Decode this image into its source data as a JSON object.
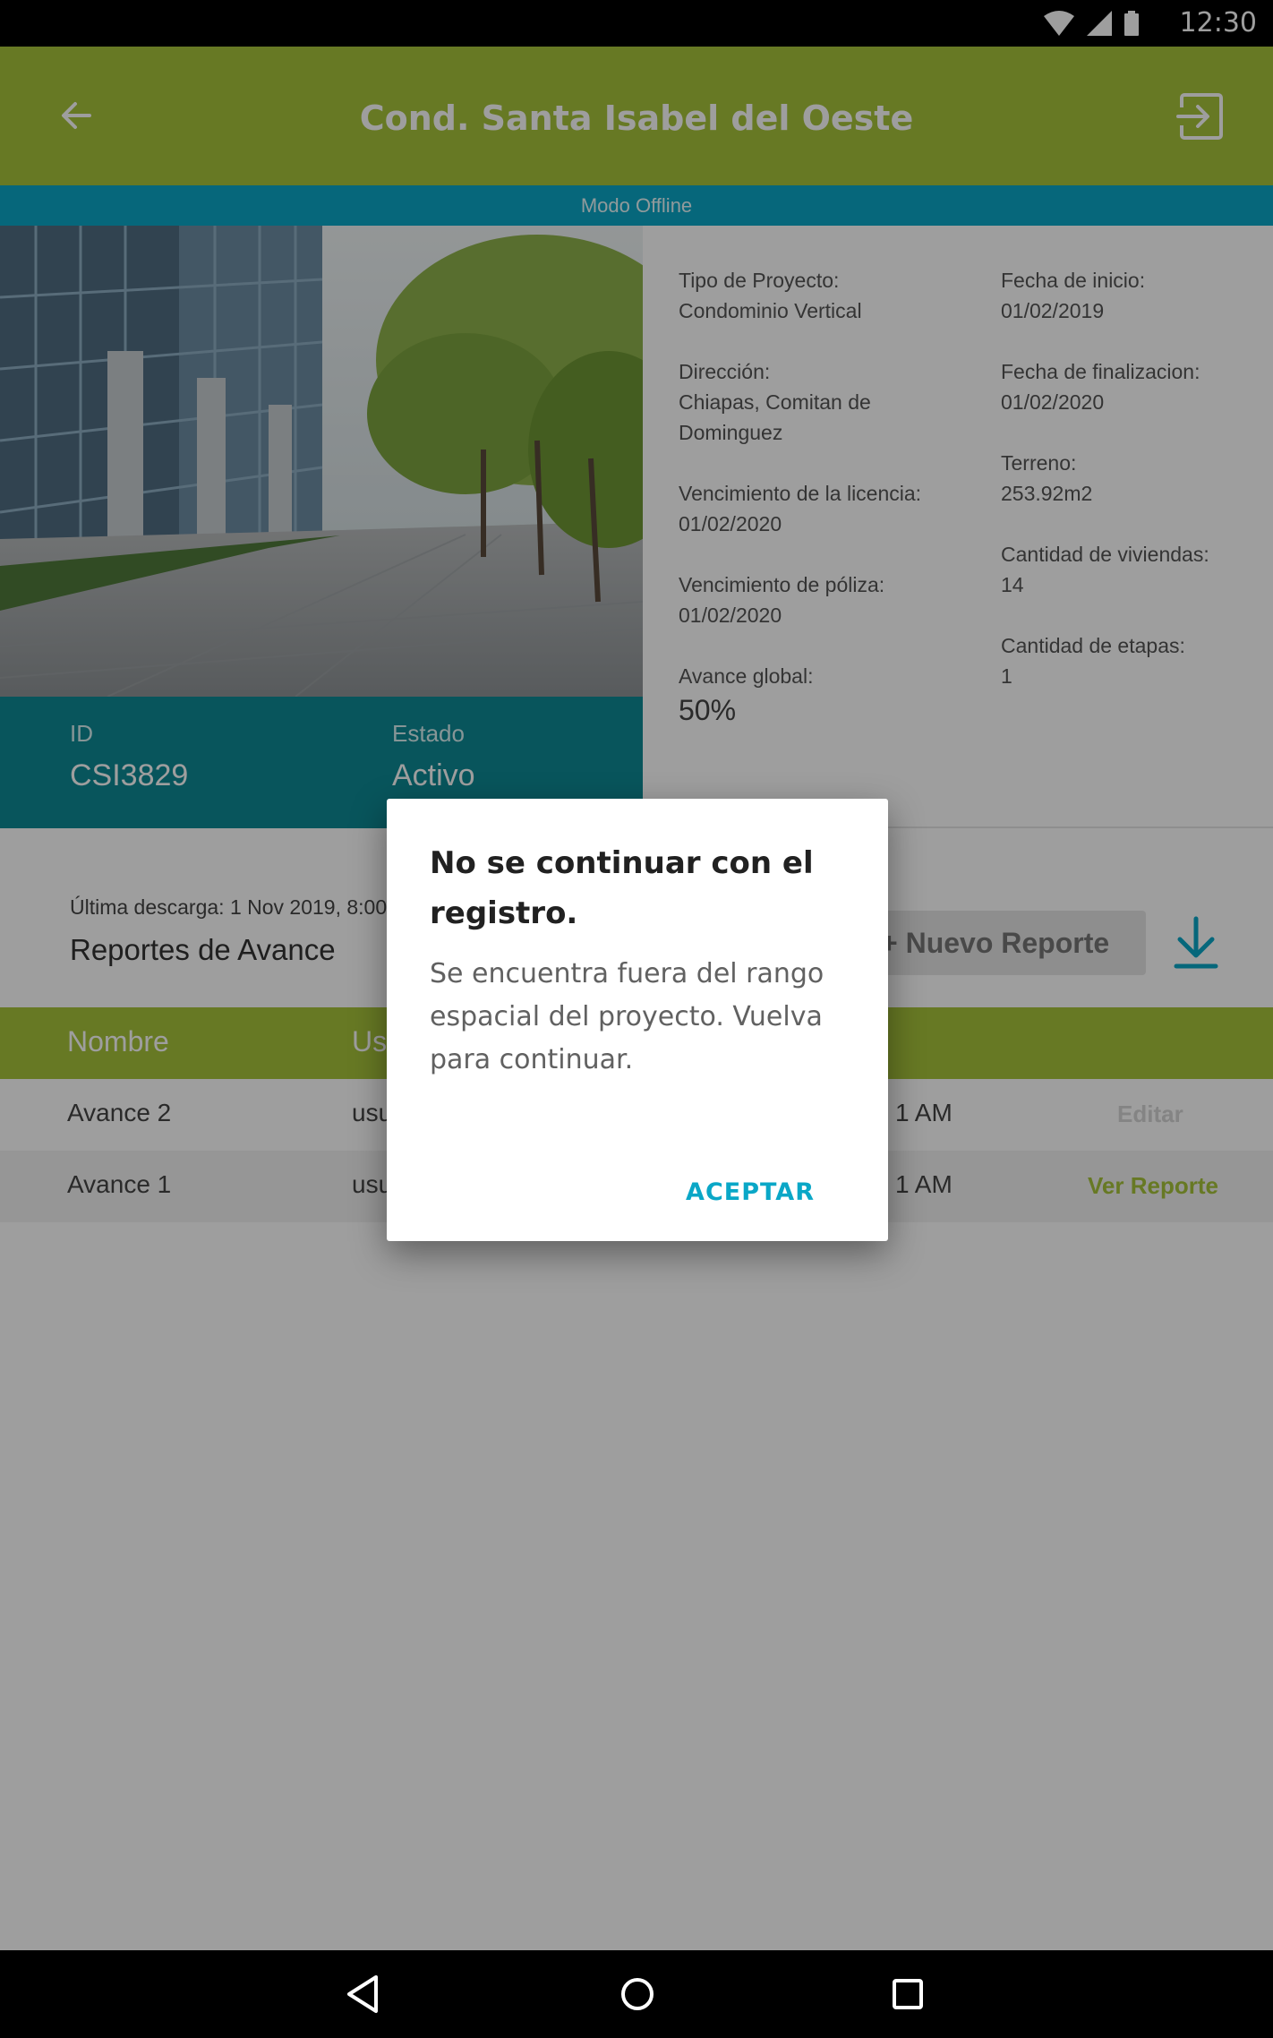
{
  "status_bar": {
    "time": "12:30",
    "icons": [
      "wifi-icon",
      "signal-icon",
      "battery-icon"
    ]
  },
  "app_bar": {
    "title": "Cond. Santa Isabel del Oeste"
  },
  "offline_banner": "Modo Offline",
  "id_panel": {
    "id_label": "ID",
    "id_value": "CSI3829",
    "status_label": "Estado",
    "status_value": "Activo"
  },
  "info": {
    "left": [
      {
        "label": "Tipo de Proyecto:",
        "value": "Condominio Vertical"
      },
      {
        "label": "Dirección:",
        "value": "Chiapas, Comitan de Dominguez"
      },
      {
        "label": "Vencimiento de la licencia:",
        "value": "01/02/2020"
      },
      {
        "label": "Vencimiento de póliza:",
        "value": "01/02/2020"
      },
      {
        "label": "Avance global:",
        "value": "50%"
      }
    ],
    "right": [
      {
        "label": "Fecha de inicio:",
        "value": "01/02/2019"
      },
      {
        "label": "Fecha de finalizacion:",
        "value": "01/02/2020"
      },
      {
        "label": "Terreno:",
        "value": "253.92m2"
      },
      {
        "label": "Cantidad de viviendas:",
        "value": "14"
      },
      {
        "label": "Cantidad de etapas:",
        "value": "1"
      }
    ]
  },
  "reports": {
    "last_download": "Última descarga: 1 Nov 2019, 8:00",
    "title": "Reportes de Avance",
    "new_button": "+ Nuevo Reporte",
    "columns": [
      "Nombre",
      "Us"
    ],
    "rows": [
      {
        "name": "Avance 2",
        "user": "usu",
        "time": "1 AM",
        "action": "Editar"
      },
      {
        "name": "Avance 1",
        "user": "usu",
        "time": "1 AM",
        "action": "Ver Reporte"
      }
    ]
  },
  "dialog": {
    "title": "No se continuar con el registro.",
    "message": "Se encuentra fuera del rango espacial del proyecto. Vuelva para continuar.",
    "accept": "ACEPTAR"
  },
  "colors": {
    "primary": "#a6c33a",
    "accent": "#0aa7c7",
    "teal": "#0d8a95"
  }
}
